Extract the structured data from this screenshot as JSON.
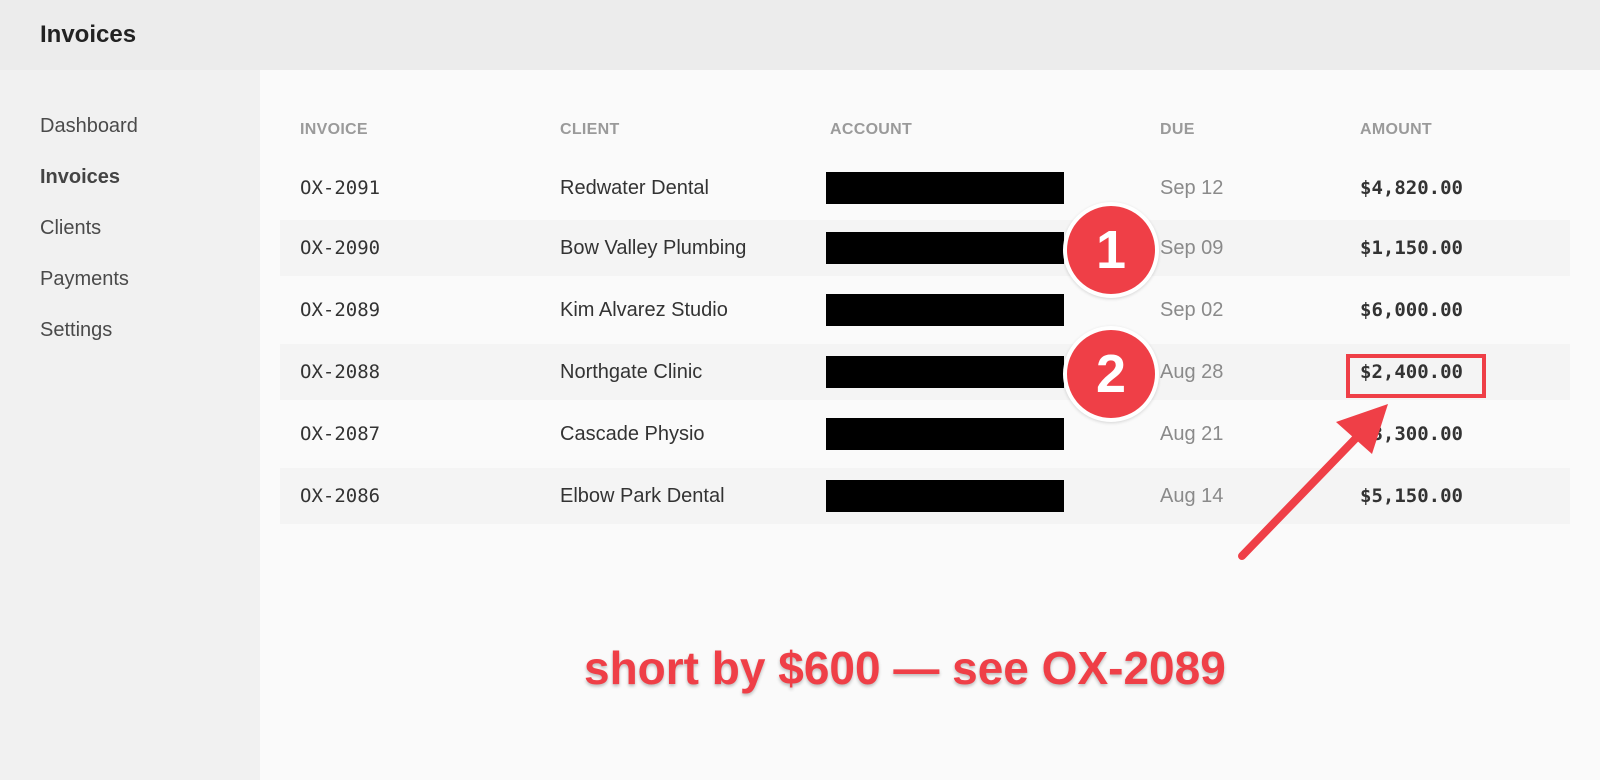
{
  "app": {
    "title": "Invoices"
  },
  "sidebar": {
    "items": [
      {
        "label": "Dashboard",
        "active": false
      },
      {
        "label": "Invoices",
        "active": true
      },
      {
        "label": "Clients",
        "active": false
      },
      {
        "label": "Payments",
        "active": false
      },
      {
        "label": "Settings",
        "active": false
      }
    ]
  },
  "table": {
    "columns": [
      "INVOICE",
      "CLIENT",
      "ACCOUNT",
      "DUE",
      "AMOUNT"
    ],
    "rows": [
      {
        "invoice": "OX-2091",
        "client": "Redwater Dental",
        "account_redacted": true,
        "due": "Sep 12",
        "amount": "$4,820.00"
      },
      {
        "invoice": "OX-2090",
        "client": "Bow Valley Plumbing",
        "account_redacted": true,
        "due": "Sep 09",
        "amount": "$1,150.00"
      },
      {
        "invoice": "OX-2089",
        "client": "Kim Alvarez Studio",
        "account_redacted": true,
        "due": "Sep 02",
        "amount": "$6,000.00"
      },
      {
        "invoice": "OX-2088",
        "client": "Northgate Clinic",
        "account_redacted": true,
        "due": "Aug 28",
        "amount": "$2,400.00"
      },
      {
        "invoice": "OX-2087",
        "client": "Cascade Physio",
        "account_redacted": true,
        "due": "Aug 21",
        "amount": "$3,300.00"
      },
      {
        "invoice": "OX-2086",
        "client": "Elbow Park Dental",
        "account_redacted": true,
        "due": "Aug 14",
        "amount": "$5,150.00"
      }
    ]
  },
  "annotations": {
    "markers": [
      "1",
      "2"
    ],
    "note": "short by $600 — see OX-2089",
    "color": "#ef3f47"
  }
}
